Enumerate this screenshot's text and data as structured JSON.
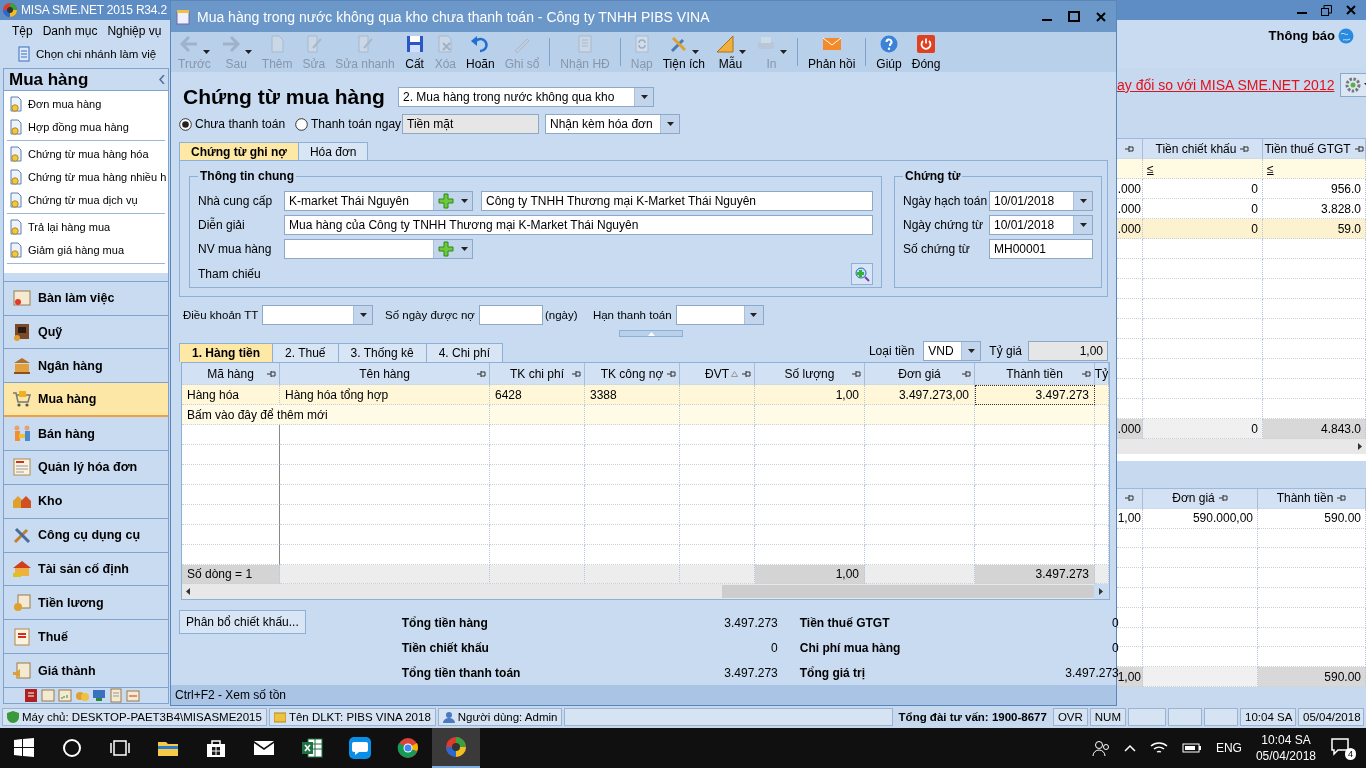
{
  "app": {
    "title": "MISA SME.NET 2015 R34.2",
    "menu": [
      "Tệp",
      "Danh mục",
      "Nghiệp vụ"
    ],
    "branch_button": "Chọn chi nhánh làm việ",
    "notice": "Thông báo",
    "changes_link": "ay đổi so với MISA SME.NET 2012"
  },
  "sidebar": {
    "title": "Mua hàng",
    "groups": [
      [
        "Đơn mua hàng",
        "Hợp đồng mua hàng"
      ],
      [
        "Chứng từ mua hàng hóa",
        "Chứng từ mua hàng nhiều h",
        "Chứng từ mua dịch vụ"
      ],
      [
        "Trả lại hàng mua",
        "Giảm giá hàng mua"
      ]
    ],
    "modules": [
      {
        "label": "Bàn làm việc",
        "selected": false
      },
      {
        "label": "Quỹ",
        "selected": false
      },
      {
        "label": "Ngân hàng",
        "selected": false
      },
      {
        "label": "Mua hàng",
        "selected": true
      },
      {
        "label": "Bán hàng",
        "selected": false
      },
      {
        "label": "Quản lý hóa đơn",
        "selected": false
      },
      {
        "label": "Kho",
        "selected": false
      },
      {
        "label": "Công cụ dụng cụ",
        "selected": false
      },
      {
        "label": "Tài sản cố định",
        "selected": false
      },
      {
        "label": "Tiền lương",
        "selected": false
      },
      {
        "label": "Thuế",
        "selected": false
      },
      {
        "label": "Giá thành",
        "selected": false
      }
    ]
  },
  "summary_grid": {
    "columns": [
      "Tiền chiết khấu",
      "Tiền thuế GTGT"
    ],
    "filter_signs": [
      "≤",
      "≤"
    ],
    "rows": [
      {
        "column_1": ".000",
        "cells": [
          "0",
          "956.0"
        ],
        "selected": false
      },
      {
        "column_1": ".000",
        "cells": [
          "0",
          "3.828.0"
        ],
        "selected": false
      },
      {
        "column_1": ".000",
        "cells": [
          "0",
          "59.0"
        ],
        "selected": true
      }
    ],
    "totals": {
      "column_1": ".000",
      "cells": [
        "0",
        "4.843.0"
      ]
    }
  },
  "detail_grid": {
    "columns": [
      "Đơn giá",
      "Thành tiền"
    ],
    "rows": [
      {
        "column_1": "1,00",
        "cells": [
          "590.000,00",
          "590.00"
        ]
      }
    ],
    "totals": {
      "column_1": "1,00",
      "amount": "590.00"
    }
  },
  "dialog": {
    "title": "Mua hàng trong nước không qua kho chưa thanh toán - Công ty TNHH PIBS VINA",
    "toolbar_groups": [
      [
        {
          "label": "Trước",
          "disabled": true,
          "dropdown": true
        },
        {
          "label": "Sau",
          "disabled": true,
          "dropdown": true
        },
        {
          "label": "Thêm",
          "disabled": true,
          "dropdown": false
        },
        {
          "label": "Sửa",
          "disabled": true,
          "dropdown": false
        },
        {
          "label": "Sửa nhanh",
          "disabled": true,
          "dropdown": false
        },
        {
          "label": "Cất",
          "disabled": false,
          "dropdown": false
        },
        {
          "label": "Xóa",
          "disabled": true,
          "dropdown": false
        },
        {
          "label": "Hoãn",
          "disabled": false,
          "dropdown": false
        },
        {
          "label": "Ghi sổ",
          "disabled": true,
          "dropdown": false
        }
      ],
      [
        {
          "label": "Nhận HĐ",
          "disabled": true,
          "dropdown": false
        }
      ],
      [
        {
          "label": "Nạp",
          "disabled": true,
          "dropdown": false
        },
        {
          "label": "Tiện ích",
          "disabled": false,
          "dropdown": true
        },
        {
          "label": "Mẫu",
          "disabled": false,
          "dropdown": true
        },
        {
          "label": "In",
          "disabled": true,
          "dropdown": true
        }
      ],
      [
        {
          "label": "Phản hồi",
          "disabled": false,
          "dropdown": false
        }
      ],
      [
        {
          "label": "Giúp",
          "disabled": false,
          "dropdown": false
        },
        {
          "label": "Đóng",
          "disabled": false,
          "dropdown": false
        }
      ]
    ],
    "form_title": "Chứng từ mua hàng",
    "voucher_type": "2. Mua hàng trong nước không qua kho",
    "payment_options": [
      {
        "label": "Chưa thanh toán",
        "selected": true
      },
      {
        "label": "Thanh toán ngay",
        "selected": false
      }
    ],
    "payment_method": "Tiền mặt",
    "invoice_option": "Nhận kèm hóa đơn",
    "tabs": [
      {
        "label": "Chứng từ ghi nợ",
        "selected": true
      },
      {
        "label": "Hóa đơn",
        "selected": false
      }
    ],
    "general": {
      "title": "Thông tin chung",
      "supplier_label": "Nhà cung cấp",
      "supplier_code": "K-market Thái Nguyên",
      "supplier_name": "Công ty TNHH Thương mại K-Market Thái Nguyên",
      "description_label": "Diễn giải",
      "description": "Mua hàng của Công ty TNHH Thương mại K-Market Thái Nguyên",
      "buyer_label": "NV mua hàng",
      "reference_label": "Tham chiếu"
    },
    "voucher": {
      "title": "Chứng từ",
      "fields": [
        {
          "label": "Ngày hạch toán",
          "value": "10/01/2018",
          "kind": "date"
        },
        {
          "label": "Ngày chứng từ",
          "value": "10/01/2018",
          "kind": "date"
        },
        {
          "label": "Số chứng từ",
          "value": "MH00001",
          "kind": "text"
        }
      ]
    },
    "terms": {
      "payment_terms_label": "Điều khoản TT",
      "days_label": "Số ngày được nợ",
      "days_unit": "(ngày)",
      "due_label": "Hạn thanh toán"
    },
    "detail_tabs": [
      {
        "label": "1. Hàng tiền",
        "selected": true
      },
      {
        "label": "2. Thuế",
        "selected": false
      },
      {
        "label": "3. Thống kê",
        "selected": false
      },
      {
        "label": "4. Chi phí",
        "selected": false
      }
    ],
    "currency_label": "Loại tiền",
    "currency": "VND",
    "rate_label": "Tỷ giá",
    "rate": "1,00",
    "grid": {
      "columns": [
        "Mã hàng",
        "Tên hàng",
        "TK chi phí",
        "TK công nợ",
        "ĐVT",
        "Số lượng",
        "Đơn giá",
        "Thành tiền",
        "Tỷ"
      ],
      "rows": [
        {
          "item_code": "Hàng hóa",
          "item_name": "Hàng hóa tổng hợp",
          "expense_account": "6428",
          "payable_account": "3388",
          "quantity": "1,00",
          "unit_price": "3.497.273,00",
          "amount": "3.497.273"
        }
      ],
      "new_row_hint": "Bấm vào đây để thêm mới",
      "footer": {
        "row_count": "Số dòng = 1",
        "quantity": "1,00",
        "amount": "3.497.273"
      }
    },
    "discount_button": "Phân bổ chiết khấu...",
    "totals": [
      {
        "label": "Tổng tiền hàng",
        "value": "3.497.273"
      },
      {
        "label": "Tiền thuế GTGT",
        "value": "0"
      },
      {
        "label": "Tiền chiết khấu",
        "value": "0"
      },
      {
        "label": "Chi phí mua hàng",
        "value": "0"
      },
      {
        "label": "Tổng tiền thanh toán",
        "value": "3.497.273"
      },
      {
        "label": "Tổng giá trị",
        "value": "3.497.273"
      }
    ],
    "hint": "Ctrl+F2 - Xem số tồn"
  },
  "status_bar": {
    "server": "Máy chủ: DESKTOP-PAET3B4\\MISASME2015",
    "database": "Tên DLKT: PIBS VINA 2018",
    "user": "Người dùng: Admin",
    "hotline": "Tổng đài tư vấn: 1900-8677",
    "indicators": [
      "OVR",
      "NUM"
    ],
    "time": "10:04 SA",
    "date": "05/04/2018"
  },
  "taskbar": {
    "apps": [
      {
        "kind": "start",
        "selected": false
      },
      {
        "kind": "search",
        "selected": false
      },
      {
        "kind": "task_view",
        "selected": false
      },
      {
        "kind": "explorer",
        "selected": false
      },
      {
        "kind": "store",
        "selected": false
      },
      {
        "kind": "mail",
        "selected": false
      },
      {
        "kind": "excel",
        "selected": false
      },
      {
        "kind": "zalo",
        "selected": false
      },
      {
        "kind": "chrome",
        "selected": false
      },
      {
        "kind": "misa",
        "selected": true
      }
    ],
    "language": "ENG",
    "clock_time": "10:04 SA",
    "clock_date": "05/04/2018",
    "notifications": "4"
  }
}
